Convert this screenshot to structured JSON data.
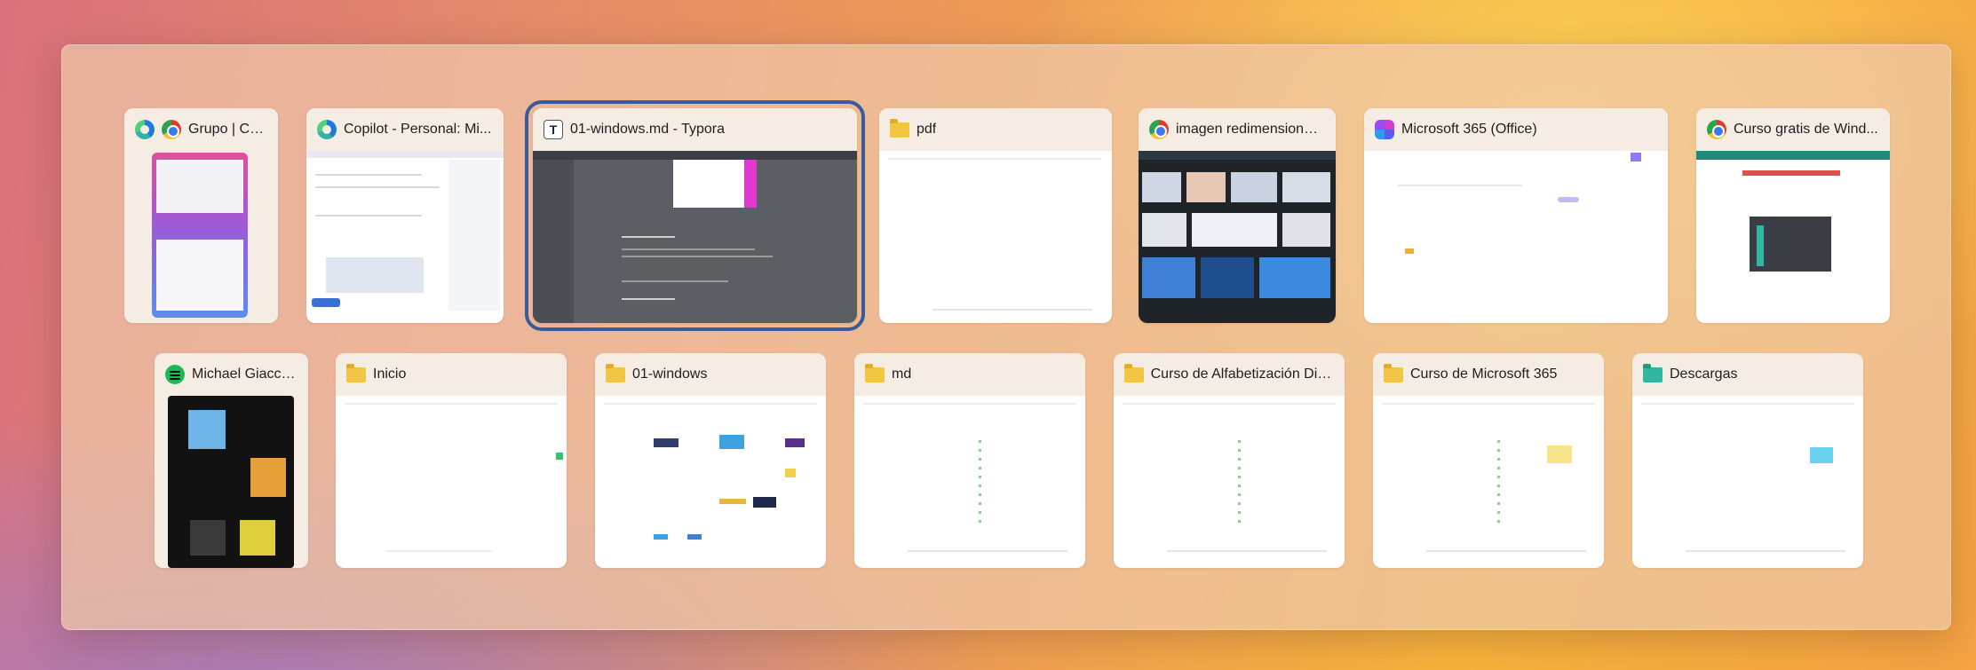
{
  "windows_row1": [
    {
      "title": "Grupo | Co...",
      "icons": [
        "edge-icon",
        "chrome-icon"
      ]
    },
    {
      "title": "Copilot - Personal: Mi...",
      "icons": [
        "edge-icon"
      ]
    },
    {
      "title": "01-windows.md - Typora",
      "icons": [
        "typora-icon"
      ],
      "selected": true
    },
    {
      "title": "pdf",
      "icons": [
        "folder-icon"
      ]
    },
    {
      "title": "imagen redimensionar...",
      "icons": [
        "chrome-icon"
      ]
    },
    {
      "title": "Microsoft 365 (Office)",
      "icons": [
        "m365-icon"
      ]
    },
    {
      "title": "Curso gratis de Wind...",
      "icons": [
        "chrome-icon"
      ]
    }
  ],
  "windows_row2": [
    {
      "title": "Michael Giacch...",
      "icons": [
        "spotify-icon"
      ]
    },
    {
      "title": "Inicio",
      "icons": [
        "folder-icon"
      ]
    },
    {
      "title": "01-windows",
      "icons": [
        "folder-icon"
      ]
    },
    {
      "title": "md",
      "icons": [
        "folder-icon"
      ]
    },
    {
      "title": "Curso de Alfabetización Dig...",
      "icons": [
        "folder-icon"
      ]
    },
    {
      "title": "Curso de Microsoft 365",
      "icons": [
        "folder-icon"
      ]
    },
    {
      "title": "Descargas",
      "icons": [
        "folder-downloads-icon"
      ]
    }
  ],
  "typora_icon_letter": "T",
  "colors": {
    "selection_outline": "#3b5a9a",
    "panel": "#eec8aa",
    "card_header": "#f5ece4"
  }
}
